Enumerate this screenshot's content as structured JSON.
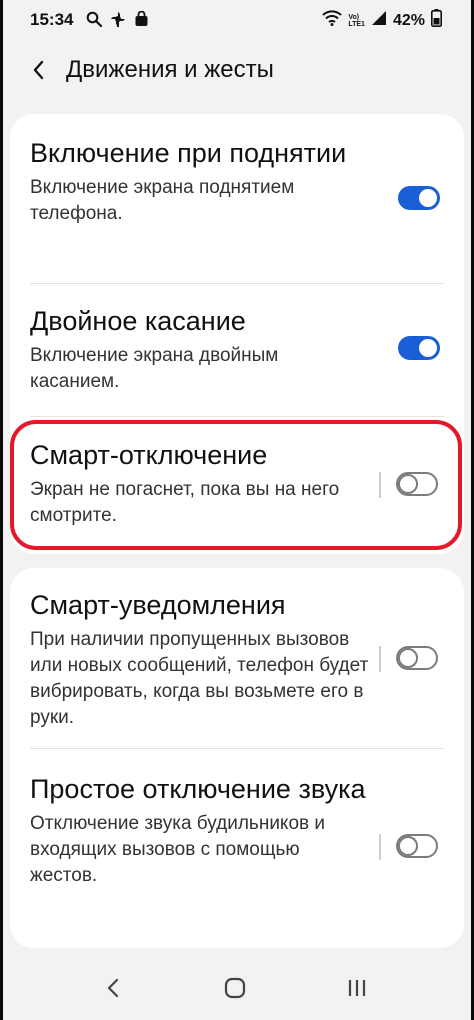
{
  "status_bar": {
    "time": "15:34",
    "network_label_top": "Vo)",
    "network_label_bottom": "LTE1",
    "battery_percent": "42%",
    "icons": [
      "search-icon",
      "pinwheel-icon",
      "shopping-bag-icon",
      "wifi-icon",
      "signal-icon",
      "battery-icon"
    ]
  },
  "header": {
    "title": "Движения и жесты",
    "back_icon": "chevron-left-icon"
  },
  "settings": {
    "lift_to_wake": {
      "title": "Включение при поднятии",
      "subtitle": "Включение экрана поднятием телефона.",
      "enabled": true
    },
    "double_tap": {
      "title": "Двойное касание",
      "subtitle": "Включение экрана двойным касанием.",
      "enabled": true
    },
    "smart_stay": {
      "title": "Смарт-отключение",
      "subtitle": "Экран не погаснет, пока вы на него смотрите.",
      "enabled": false
    },
    "smart_alert": {
      "title": "Смарт-уведомления",
      "subtitle": "При наличии пропущенных вызовов или новых сообщений, телефон будет вибрировать, когда вы возьмете его в руки.",
      "enabled": false
    },
    "easy_mute": {
      "title": "Простое отключение звука",
      "subtitle": "Отключение звука будильников и входящих вызовов с помощью жестов.",
      "enabled": false
    }
  },
  "highlight_color": "#e3182a",
  "accent_color": "#1a5fd6",
  "nav_bar": {
    "icons": [
      "back-icon",
      "home-icon",
      "recents-icon"
    ]
  }
}
